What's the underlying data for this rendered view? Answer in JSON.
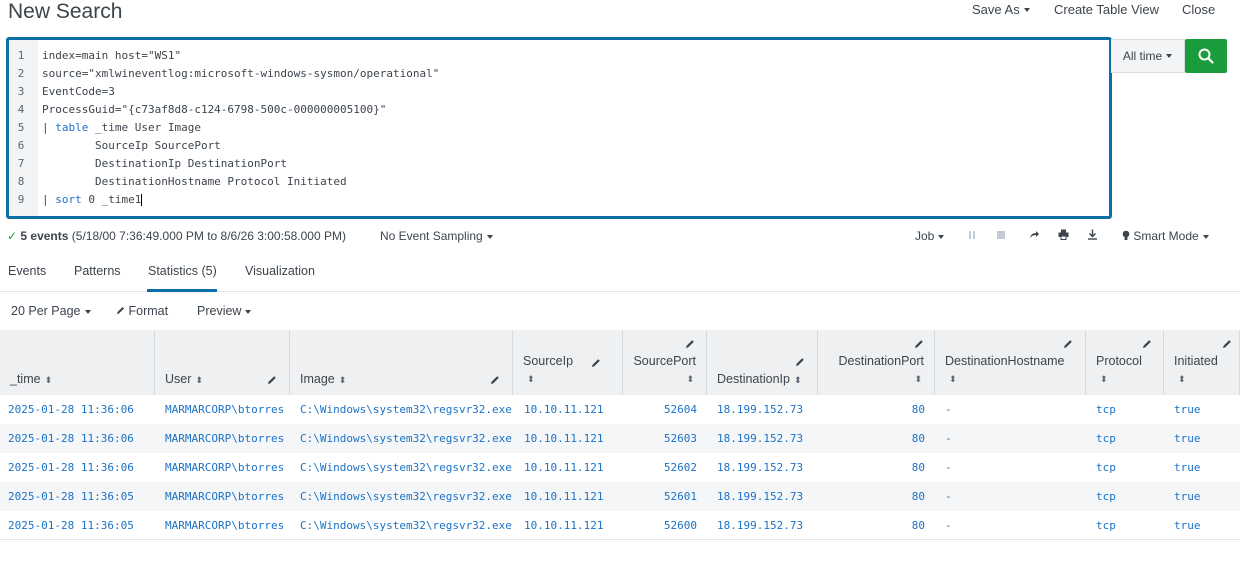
{
  "header": {
    "title": "New Search",
    "save_as": "Save As",
    "create_table_view": "Create Table View",
    "close": "Close"
  },
  "editor": {
    "lines": [
      {
        "n": "1",
        "text": "index=main host=\"WS1\""
      },
      {
        "n": "2",
        "text": "source=\"xmlwineventlog:microsoft-windows-sysmon/operational\""
      },
      {
        "n": "3",
        "text": "EventCode=3"
      },
      {
        "n": "4",
        "text": "ProcessGuid=\"{c73af8d8-c124-6798-500c-000000005100}\""
      },
      {
        "n": "5",
        "pipe": "| ",
        "kw": "table",
        "text": " _time User Image"
      },
      {
        "n": "6",
        "text": "        SourceIp SourcePort"
      },
      {
        "n": "7",
        "text": "        DestinationIp DestinationPort"
      },
      {
        "n": "8",
        "text": "        DestinationHostname Protocol Initiated"
      },
      {
        "n": "9",
        "pipe": "| ",
        "kw": "sort",
        "text": " 0 _time1"
      }
    ]
  },
  "time_picker": {
    "label": "All time"
  },
  "status": {
    "count": "5 events",
    "range": "(5/18/00 7:36:49.000 PM to 8/6/26 3:00:58.000 PM)",
    "sampling": "No Event Sampling",
    "job": "Job",
    "mode": "Smart Mode"
  },
  "tabs": [
    {
      "label": "Events"
    },
    {
      "label": "Patterns"
    },
    {
      "label": "Statistics (5)"
    },
    {
      "label": "Visualization"
    }
  ],
  "toolbar": {
    "per_page": "20 Per Page",
    "format": "Format",
    "preview": "Preview"
  },
  "table": {
    "columns": [
      "_time",
      "User",
      "Image",
      "SourceIp",
      "SourcePort",
      "DestinationIp",
      "DestinationPort",
      "DestinationHostname",
      "Protocol",
      "Initiated"
    ],
    "rows": [
      [
        "2025-01-28 11:36:06",
        "MARMARCORP\\btorres",
        "C:\\Windows\\system32\\regsvr32.exe",
        "10.10.11.121",
        "52604",
        "18.199.152.73",
        "80",
        "-",
        "tcp",
        "true"
      ],
      [
        "2025-01-28 11:36:06",
        "MARMARCORP\\btorres",
        "C:\\Windows\\system32\\regsvr32.exe",
        "10.10.11.121",
        "52603",
        "18.199.152.73",
        "80",
        "-",
        "tcp",
        "true"
      ],
      [
        "2025-01-28 11:36:06",
        "MARMARCORP\\btorres",
        "C:\\Windows\\system32\\regsvr32.exe",
        "10.10.11.121",
        "52602",
        "18.199.152.73",
        "80",
        "-",
        "tcp",
        "true"
      ],
      [
        "2025-01-28 11:36:05",
        "MARMARCORP\\btorres",
        "C:\\Windows\\system32\\regsvr32.exe",
        "10.10.11.121",
        "52601",
        "18.199.152.73",
        "80",
        "-",
        "tcp",
        "true"
      ],
      [
        "2025-01-28 11:36:05",
        "MARMARCORP\\btorres",
        "C:\\Windows\\system32\\regsvr32.exe",
        "10.10.11.121",
        "52600",
        "18.199.152.73",
        "80",
        "-",
        "tcp",
        "true"
      ]
    ]
  },
  "colors": {
    "accent": "#0e6ea7",
    "search_button": "#1a9c3c",
    "link": "#1b72c7"
  }
}
